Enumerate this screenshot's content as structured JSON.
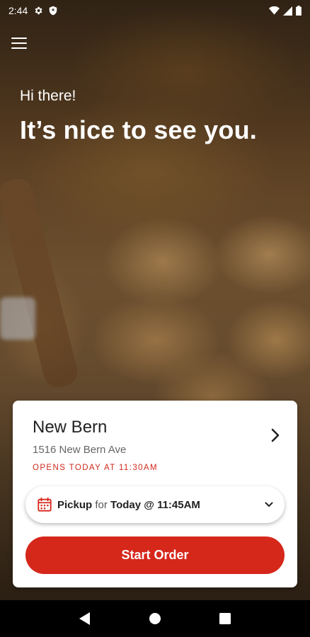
{
  "status_bar": {
    "time": "2:44",
    "icons": [
      "gear-icon",
      "shield-icon",
      "wifi-icon",
      "signal-icon",
      "battery-icon"
    ]
  },
  "header": {
    "menu_icon": "hamburger-menu-icon"
  },
  "hero": {
    "greeting": "Hi there!",
    "headline": "It’s nice to see you."
  },
  "location": {
    "name": "New Bern",
    "address": "1516 New Bern Ave",
    "hours": "OPENS TODAY AT 11:30AM"
  },
  "pickup": {
    "mode": "Pickup",
    "connector": "for",
    "time": "Today @ 11:45AM"
  },
  "start_order": {
    "label": "Start Order"
  },
  "colors": {
    "accent": "#d6271b",
    "hours_text": "#d0281b"
  }
}
